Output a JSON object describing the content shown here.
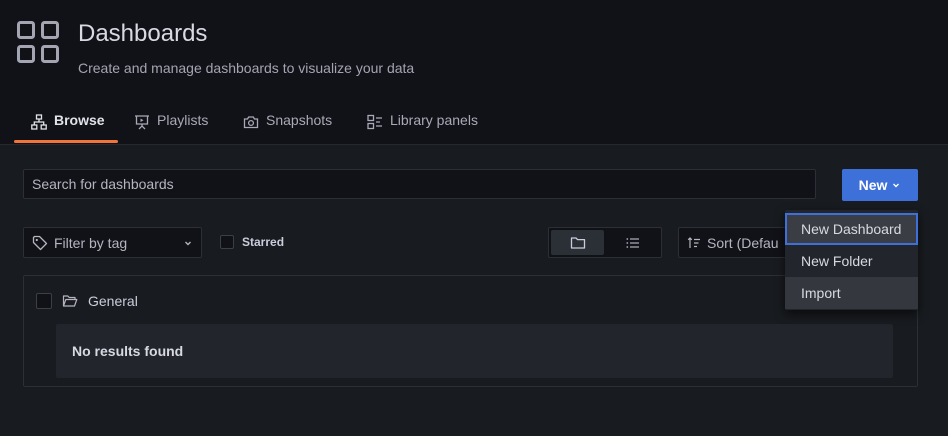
{
  "header": {
    "title": "Dashboards",
    "subtitle": "Create and manage dashboards to visualize your data",
    "icon": "apps-grid-icon"
  },
  "tabs": [
    {
      "label": "Browse",
      "icon": "sitemap-icon",
      "active": true
    },
    {
      "label": "Playlists",
      "icon": "presentation-play-icon",
      "active": false
    },
    {
      "label": "Snapshots",
      "icon": "camera-icon",
      "active": false
    },
    {
      "label": "Library panels",
      "icon": "library-panel-icon",
      "active": false
    }
  ],
  "search": {
    "placeholder": "Search for dashboards",
    "value": ""
  },
  "new_button": {
    "label": "New"
  },
  "filters": {
    "tag_placeholder": "Filter by tag",
    "starred_label": "Starred",
    "sort_label": "Sort (Defau"
  },
  "view_modes": [
    "folder-view",
    "list-view"
  ],
  "folder": {
    "name": "General",
    "empty_text": "No results found"
  },
  "new_menu": [
    {
      "label": "New Dashboard",
      "state": "focused"
    },
    {
      "label": "New Folder",
      "state": "normal"
    },
    {
      "label": "Import",
      "state": "hover"
    }
  ],
  "colors": {
    "accent": "#3d71d9",
    "tab_underline": "#f1743a",
    "background": "#111217",
    "panel": "#181b1f"
  }
}
